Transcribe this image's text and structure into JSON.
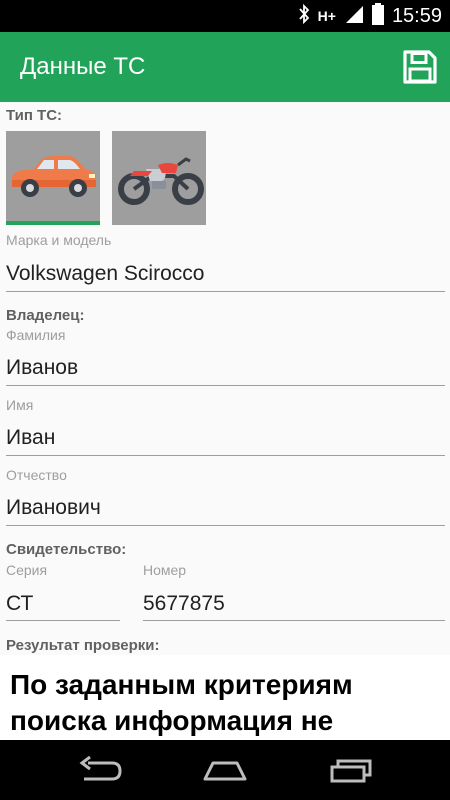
{
  "status_bar": {
    "bluetooth_icon": "bluetooth-icon",
    "network_label": "H+",
    "time": "15:59"
  },
  "app_bar": {
    "title": "Данные ТС",
    "save_icon": "floppy-disk-icon",
    "color": "#22a35a"
  },
  "vehicle_type": {
    "label": "Тип ТС:",
    "options": [
      {
        "name": "car",
        "icon": "car-icon",
        "selected": true
      },
      {
        "name": "motorcycle",
        "icon": "motorcycle-icon",
        "selected": false
      }
    ]
  },
  "make_model": {
    "label": "Марка и модель",
    "value": "Volkswagen Scirocco"
  },
  "owner": {
    "label": "Владелец:",
    "surname_label": "Фамилия",
    "surname_value": "Иванов",
    "name_label": "Имя",
    "name_value": "Иван",
    "patronymic_label": "Отчество",
    "patronymic_value": "Иванович"
  },
  "certificate": {
    "label": "Свидетельство:",
    "series_label": "Серия",
    "series_value": "СТ",
    "number_label": "Номер",
    "number_value": "5677875"
  },
  "result": {
    "label": "Результат проверки:",
    "text": "По заданным критериям поиска информация не"
  },
  "nav": {
    "back_icon": "back-icon",
    "home_icon": "home-icon",
    "recents_icon": "recents-icon"
  }
}
